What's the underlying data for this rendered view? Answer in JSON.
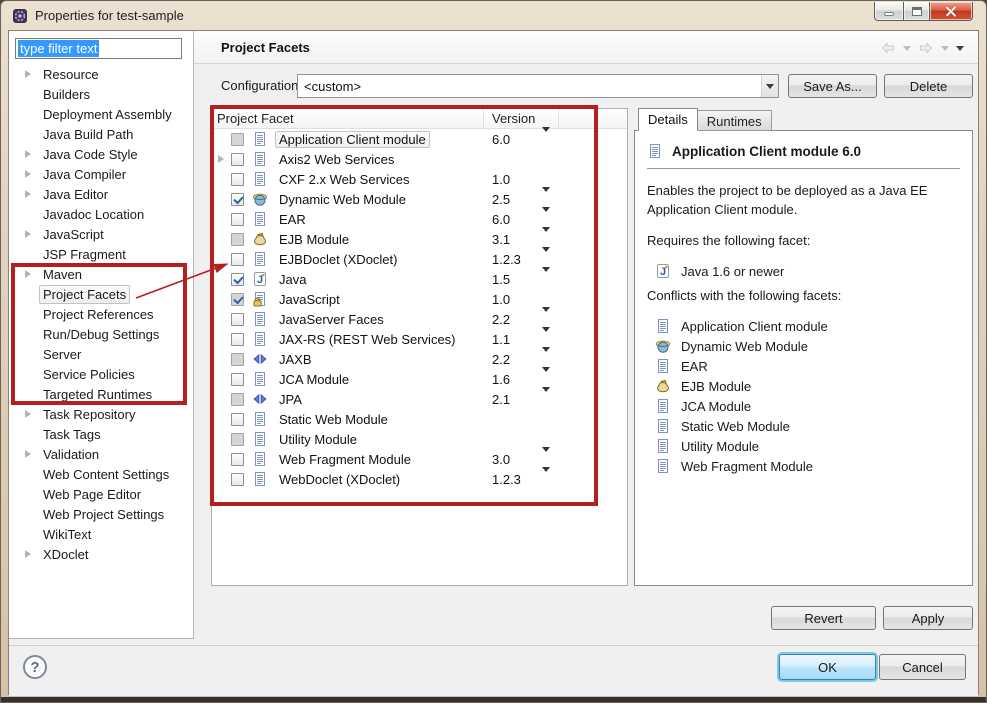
{
  "window": {
    "title": "Properties for test-sample"
  },
  "titlebar": {
    "buttons": [
      "minimize",
      "maximize",
      "close"
    ]
  },
  "sidebar": {
    "filter_text": "type filter text",
    "items": [
      {
        "label": "Resource",
        "expandable": true
      },
      {
        "label": "Builders",
        "expandable": false
      },
      {
        "label": "Deployment Assembly",
        "expandable": false
      },
      {
        "label": "Java Build Path",
        "expandable": false
      },
      {
        "label": "Java Code Style",
        "expandable": true
      },
      {
        "label": "Java Compiler",
        "expandable": true
      },
      {
        "label": "Java Editor",
        "expandable": true
      },
      {
        "label": "Javadoc Location",
        "expandable": false
      },
      {
        "label": "JavaScript",
        "expandable": true
      },
      {
        "label": "JSP Fragment",
        "expandable": false
      },
      {
        "label": "Maven",
        "expandable": true
      },
      {
        "label": "Project Facets",
        "expandable": false,
        "selected": true
      },
      {
        "label": "Project References",
        "expandable": false
      },
      {
        "label": "Run/Debug Settings",
        "expandable": false
      },
      {
        "label": "Server",
        "expandable": false
      },
      {
        "label": "Service Policies",
        "expandable": false
      },
      {
        "label": "Targeted Runtimes",
        "expandable": false
      },
      {
        "label": "Task Repository",
        "expandable": true
      },
      {
        "label": "Task Tags",
        "expandable": false
      },
      {
        "label": "Validation",
        "expandable": true
      },
      {
        "label": "Web Content Settings",
        "expandable": false
      },
      {
        "label": "Web Page Editor",
        "expandable": false
      },
      {
        "label": "Web Project Settings",
        "expandable": false
      },
      {
        "label": "WikiText",
        "expandable": false
      },
      {
        "label": "XDoclet",
        "expandable": true
      }
    ]
  },
  "header": {
    "title": "Project Facets",
    "nav_icons": [
      "back-icon",
      "back-menu-caret",
      "forward-icon",
      "forward-menu-caret",
      "view-menu-caret"
    ]
  },
  "config": {
    "label": "Configuration:",
    "value": "<custom>",
    "save_as_label": "Save As...",
    "delete_label": "Delete"
  },
  "facet_table": {
    "columns": [
      "Project Facet",
      "Version"
    ],
    "rows": [
      {
        "name": "Application Client module",
        "icon": "doc",
        "version": "6.0",
        "dropdown": true,
        "checked": false,
        "disabled": true,
        "expandable": false,
        "selected": true
      },
      {
        "name": "Axis2 Web Services",
        "icon": "doc",
        "version": "",
        "dropdown": false,
        "checked": false,
        "disabled": false,
        "expandable": true
      },
      {
        "name": "CXF 2.x Web Services",
        "icon": "doc",
        "version": "1.0",
        "dropdown": false,
        "checked": false,
        "disabled": false,
        "expandable": false
      },
      {
        "name": "Dynamic Web Module",
        "icon": "globe",
        "version": "2.5",
        "dropdown": true,
        "checked": true,
        "disabled": false,
        "expandable": false
      },
      {
        "name": "EAR",
        "icon": "doc",
        "version": "6.0",
        "dropdown": true,
        "checked": false,
        "disabled": false,
        "expandable": false
      },
      {
        "name": "EJB Module",
        "icon": "ejb",
        "version": "3.1",
        "dropdown": true,
        "checked": false,
        "disabled": true,
        "expandable": false
      },
      {
        "name": "EJBDoclet (XDoclet)",
        "icon": "doc",
        "version": "1.2.3",
        "dropdown": true,
        "checked": false,
        "disabled": false,
        "expandable": false
      },
      {
        "name": "Java",
        "icon": "java",
        "version": "1.5",
        "dropdown": true,
        "checked": true,
        "disabled": false,
        "expandable": false
      },
      {
        "name": "JavaScript",
        "icon": "js",
        "version": "1.0",
        "dropdown": false,
        "checked": true,
        "disabled": true,
        "expandable": false
      },
      {
        "name": "JavaServer Faces",
        "icon": "doc",
        "version": "2.2",
        "dropdown": true,
        "checked": false,
        "disabled": false,
        "expandable": false
      },
      {
        "name": "JAX-RS (REST Web Services)",
        "icon": "doc",
        "version": "1.1",
        "dropdown": true,
        "checked": false,
        "disabled": false,
        "expandable": false
      },
      {
        "name": "JAXB",
        "icon": "xml",
        "version": "2.2",
        "dropdown": true,
        "checked": false,
        "disabled": true,
        "expandable": false
      },
      {
        "name": "JCA Module",
        "icon": "doc",
        "version": "1.6",
        "dropdown": true,
        "checked": false,
        "disabled": false,
        "expandable": false
      },
      {
        "name": "JPA",
        "icon": "xml",
        "version": "2.1",
        "dropdown": true,
        "checked": false,
        "disabled": true,
        "expandable": false
      },
      {
        "name": "Static Web Module",
        "icon": "doc",
        "version": "",
        "dropdown": false,
        "checked": false,
        "disabled": false,
        "expandable": false
      },
      {
        "name": "Utility Module",
        "icon": "doc",
        "version": "",
        "dropdown": false,
        "checked": false,
        "disabled": true,
        "expandable": false
      },
      {
        "name": "Web Fragment Module",
        "icon": "doc",
        "version": "3.0",
        "dropdown": true,
        "checked": false,
        "disabled": false,
        "expandable": false
      },
      {
        "name": "WebDoclet (XDoclet)",
        "icon": "doc",
        "version": "1.2.3",
        "dropdown": true,
        "checked": false,
        "disabled": false,
        "expandable": false
      }
    ]
  },
  "details": {
    "tabs": [
      "Details",
      "Runtimes"
    ],
    "active_tab": "Details",
    "heading": "Application Client module 6.0",
    "description": "Enables the project to be deployed as a Java EE Application Client module.",
    "requires_label": "Requires the following facet:",
    "requires": [
      {
        "name": "Java 1.6 or newer",
        "icon": "java"
      }
    ],
    "conflicts_label": "Conflicts with the following facets:",
    "conflicts": [
      {
        "name": "Application Client module",
        "icon": "doc"
      },
      {
        "name": "Dynamic Web Module",
        "icon": "globe"
      },
      {
        "name": "EAR",
        "icon": "doc"
      },
      {
        "name": "EJB Module",
        "icon": "ejb"
      },
      {
        "name": "JCA Module",
        "icon": "doc"
      },
      {
        "name": "Static Web Module",
        "icon": "doc"
      },
      {
        "name": "Utility Module",
        "icon": "doc"
      },
      {
        "name": "Web Fragment Module",
        "icon": "doc"
      }
    ]
  },
  "buttons": {
    "revert": "Revert",
    "apply": "Apply",
    "ok": "OK",
    "cancel": "Cancel",
    "help": "?"
  },
  "colors": {
    "annotation_red": "#b3201f",
    "selection_blue": "#3399ff",
    "default_button_ring": "#7cc8ea"
  }
}
